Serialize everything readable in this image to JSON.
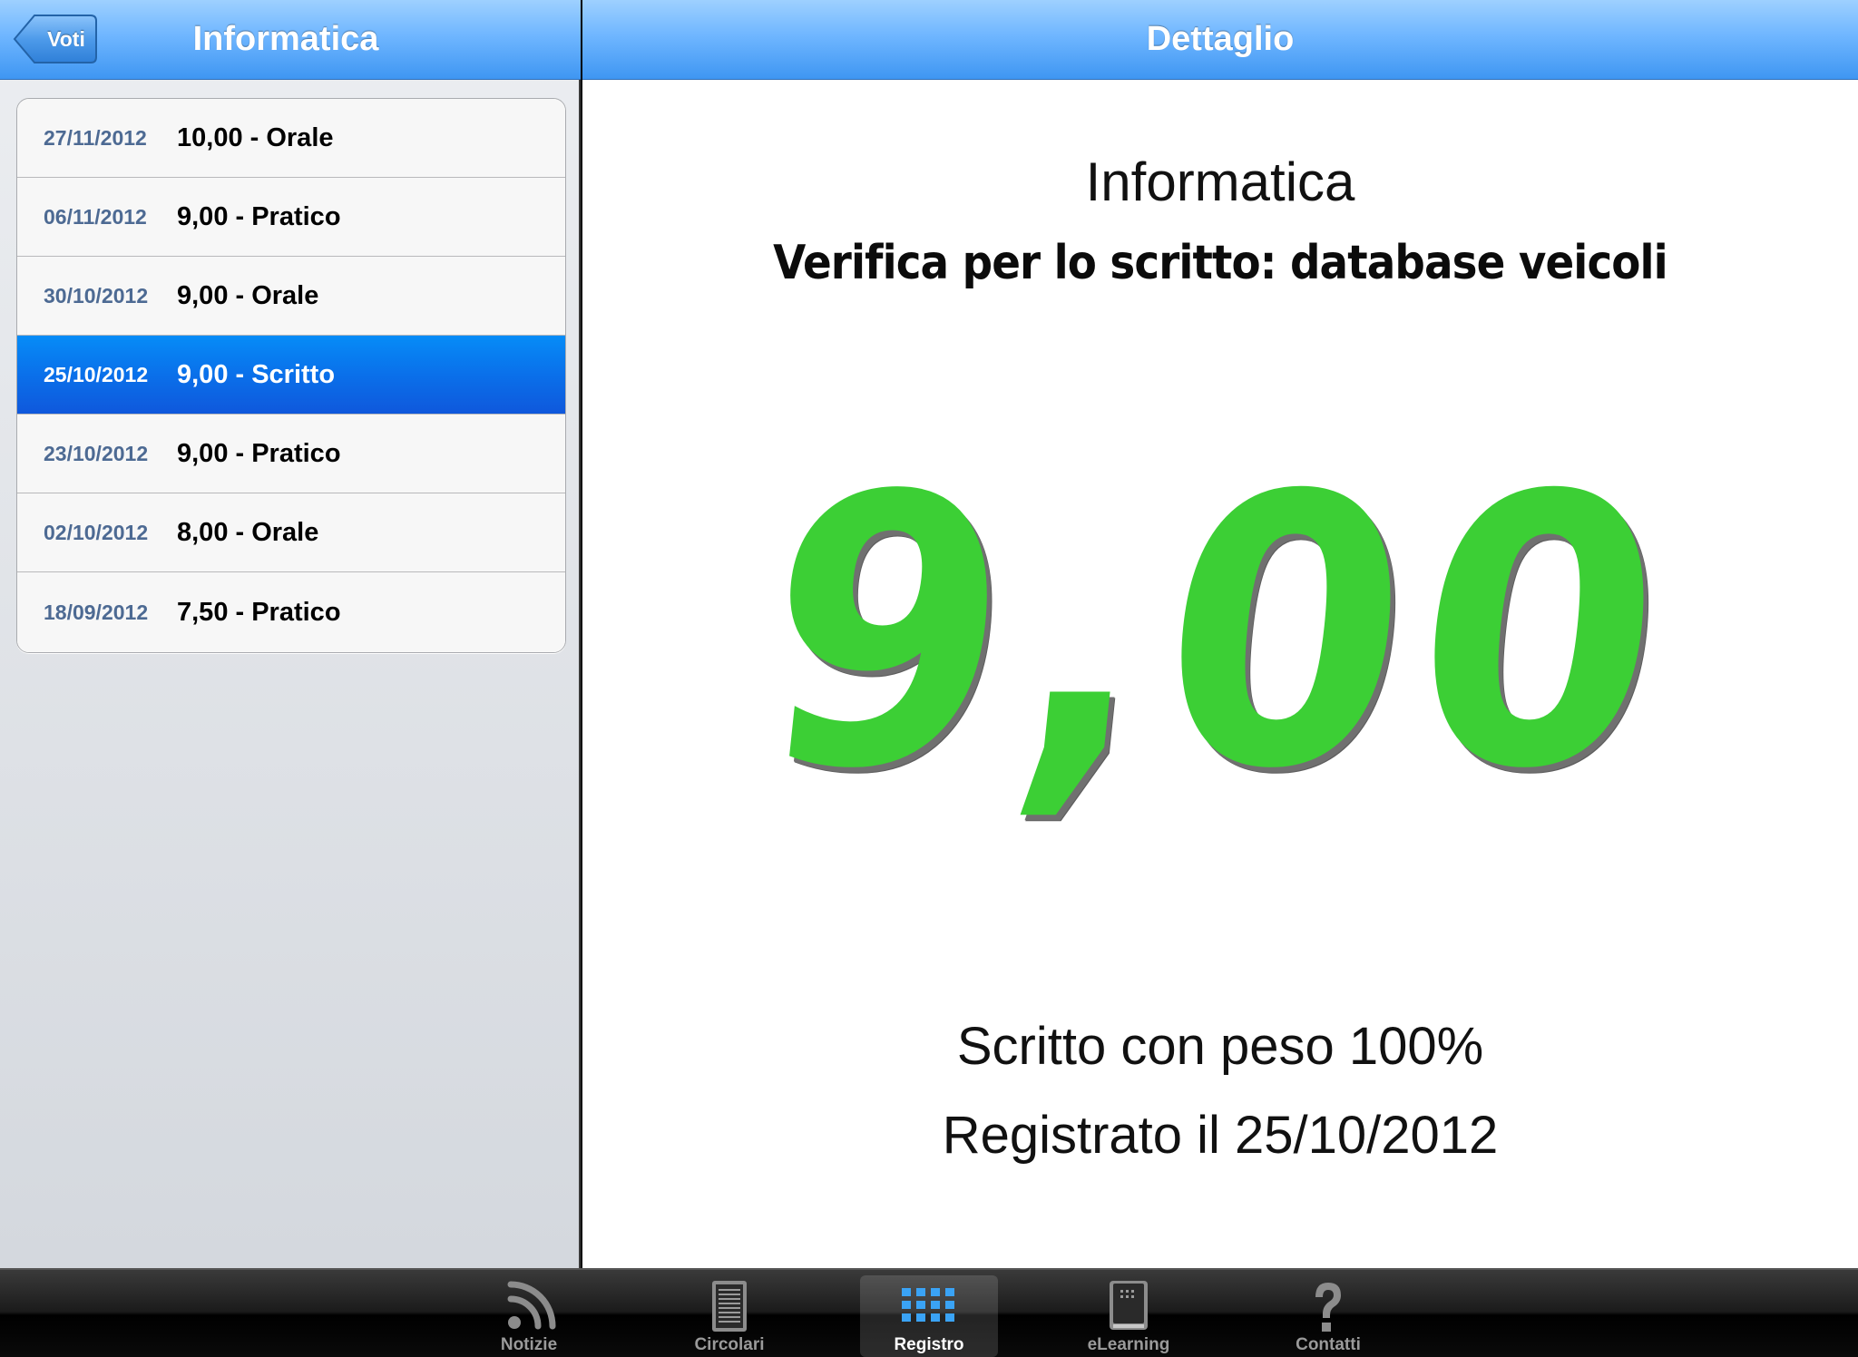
{
  "left_nav": {
    "back_label": "Voti",
    "title": "Informatica"
  },
  "grades": [
    {
      "date": "27/11/2012",
      "text": "10,00 - Orale",
      "selected": false
    },
    {
      "date": "06/11/2012",
      "text": "9,00 - Pratico",
      "selected": false
    },
    {
      "date": "30/10/2012",
      "text": "9,00 - Orale",
      "selected": false
    },
    {
      "date": "25/10/2012",
      "text": "9,00 - Scritto",
      "selected": true
    },
    {
      "date": "23/10/2012",
      "text": "9,00 - Pratico",
      "selected": false
    },
    {
      "date": "02/10/2012",
      "text": "8,00 - Orale",
      "selected": false
    },
    {
      "date": "18/09/2012",
      "text": "7,50 - Pratico",
      "selected": false
    }
  ],
  "right_nav": {
    "title": "Dettaglio"
  },
  "detail": {
    "subject": "Informatica",
    "description": "Verifica per lo scritto: database veicoli",
    "grade": "9,00",
    "weight": "Scritto con peso 100%",
    "registered": "Registrato il 25/10/2012"
  },
  "tabs": [
    {
      "label": "Notizie",
      "icon": "rss-icon",
      "active": false
    },
    {
      "label": "Circolari",
      "icon": "document-icon",
      "active": false
    },
    {
      "label": "Registro",
      "icon": "grid-icon",
      "active": true
    },
    {
      "label": "eLearning",
      "icon": "book-icon",
      "active": false
    },
    {
      "label": "Contatti",
      "icon": "question-icon",
      "active": false
    }
  ],
  "colors": {
    "accent": "#3f96f2",
    "selected_row": "#0a70ea",
    "grade_green": "#3ccf35"
  }
}
